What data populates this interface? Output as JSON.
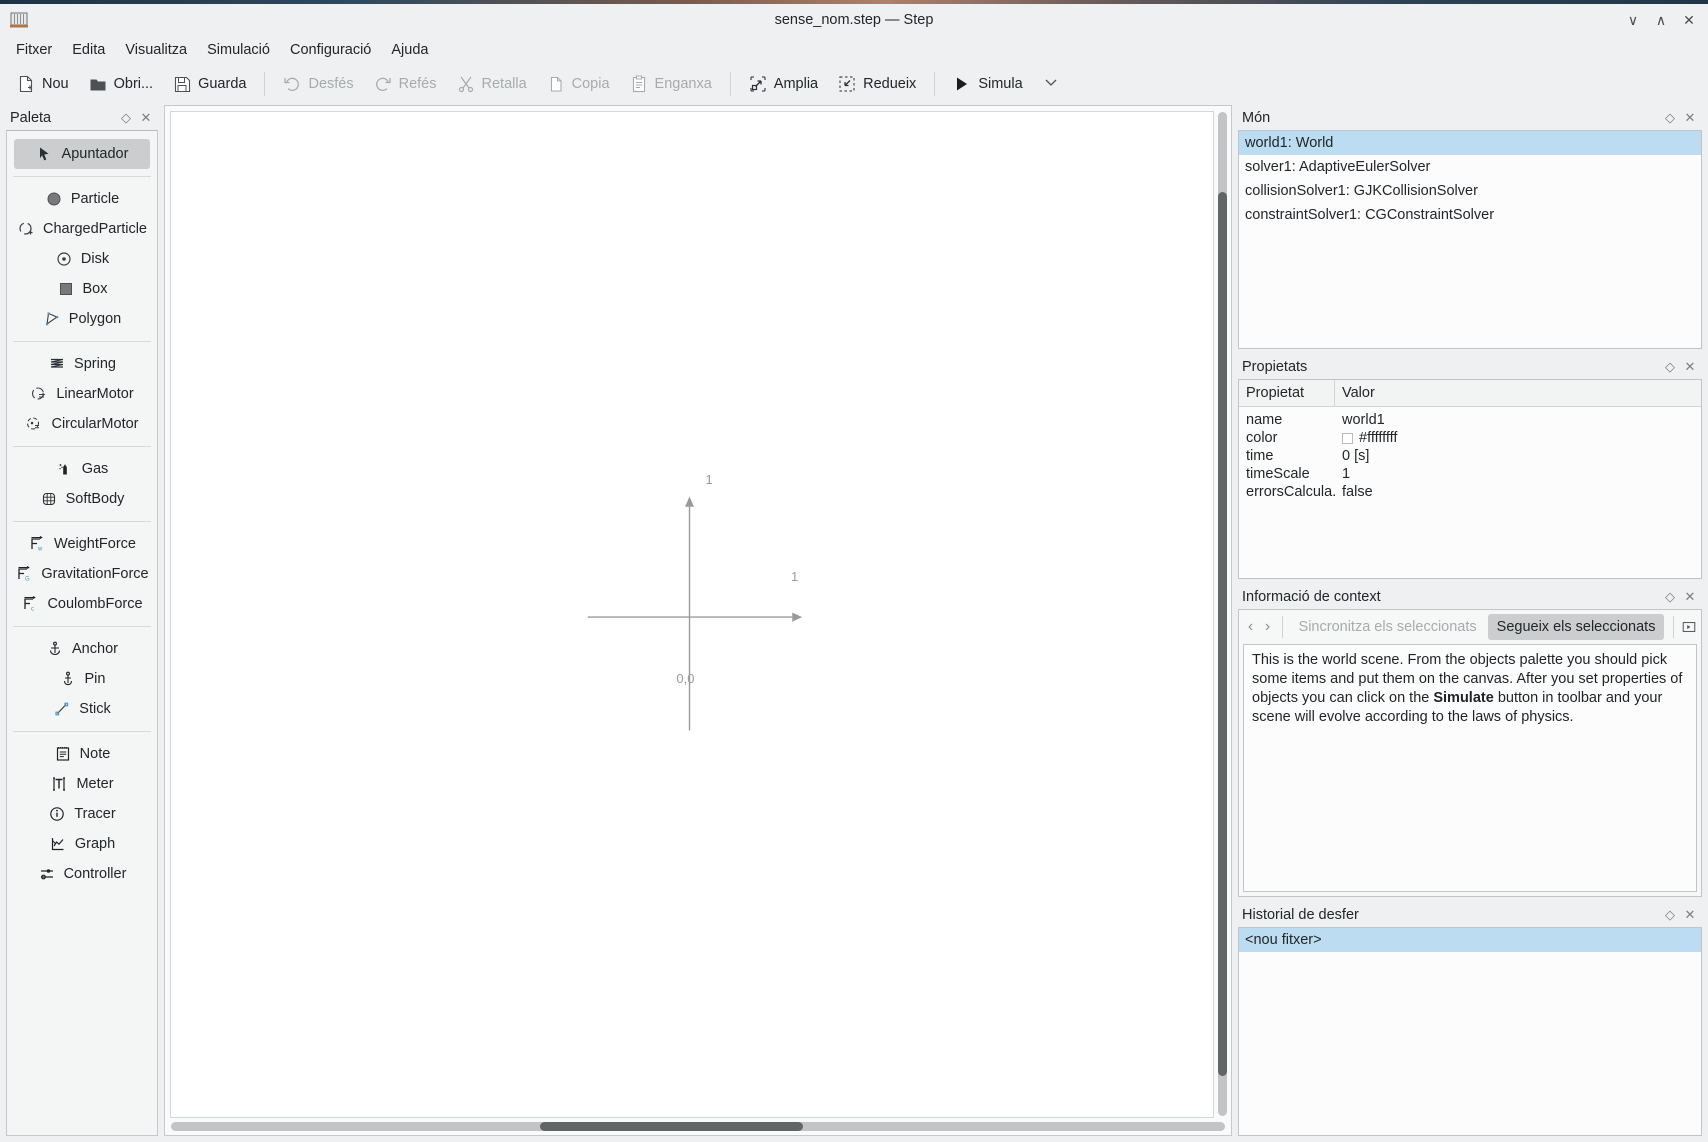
{
  "window": {
    "title": "sense_nom.step — Step",
    "app_icon": "book-icon",
    "buttons": [
      {
        "name": "minimize",
        "glyph": "∨"
      },
      {
        "name": "maximize",
        "glyph": "∧"
      },
      {
        "name": "close",
        "glyph": "✕"
      }
    ]
  },
  "menubar": {
    "items": [
      "Fitxer",
      "Edita",
      "Visualitza",
      "Simulació",
      "Configuració",
      "Ajuda"
    ]
  },
  "toolbar": {
    "items": [
      {
        "label": "Nou",
        "icon": "new-document-icon",
        "enabled": true
      },
      {
        "label": "Obri...",
        "icon": "folder-open-icon",
        "enabled": true
      },
      {
        "label": "Guarda",
        "icon": "floppy-save-icon",
        "enabled": true
      },
      {
        "separator": true
      },
      {
        "label": "Desfés",
        "icon": "undo-arrow-icon",
        "enabled": false
      },
      {
        "label": "Refés",
        "icon": "redo-arrow-icon",
        "enabled": false
      },
      {
        "label": "Retalla",
        "icon": "scissors-icon",
        "enabled": false
      },
      {
        "label": "Copia",
        "icon": "copy-page-icon",
        "enabled": false
      },
      {
        "label": "Enganxa",
        "icon": "clipboard-paste-icon",
        "enabled": false
      },
      {
        "separator": true
      },
      {
        "label": "Amplia",
        "icon": "zoom-in-icon",
        "enabled": true
      },
      {
        "label": "Redueix",
        "icon": "zoom-out-icon",
        "enabled": true
      },
      {
        "separator": true
      },
      {
        "label": "Simula",
        "icon": "play-triangle-icon",
        "enabled": true
      },
      {
        "label": "",
        "icon": "chevron-down-icon",
        "enabled": true
      }
    ]
  },
  "palette": {
    "title": "Paleta",
    "float_glyph": "◇",
    "close_glyph": "✕",
    "groups": [
      [
        {
          "label": "Apuntador",
          "icon": "cursor-arrow-icon",
          "selected": true
        }
      ],
      [
        {
          "label": "Particle",
          "icon": "filled-circle-icon"
        },
        {
          "label": "ChargedParticle",
          "icon": "charged-particle-icon"
        },
        {
          "label": "Disk",
          "icon": "disk-icon"
        },
        {
          "label": "Box",
          "icon": "filled-square-icon"
        },
        {
          "label": "Polygon",
          "icon": "polygon-icon"
        }
      ],
      [
        {
          "label": "Spring",
          "icon": "spring-coil-icon"
        },
        {
          "label": "LinearMotor",
          "icon": "linear-motor-icon"
        },
        {
          "label": "CircularMotor",
          "icon": "circular-motor-icon"
        }
      ],
      [
        {
          "label": "Gas",
          "icon": "gas-bottle-icon"
        },
        {
          "label": "SoftBody",
          "icon": "soft-body-grid-icon"
        }
      ],
      [
        {
          "label": "WeightForce",
          "icon": "force-vector-w-icon"
        },
        {
          "label": "GravitationForce",
          "icon": "force-vector-g-icon"
        },
        {
          "label": "CoulombForce",
          "icon": "force-vector-c-icon"
        }
      ],
      [
        {
          "label": "Anchor",
          "icon": "anchor-icon"
        },
        {
          "label": "Pin",
          "icon": "pin-icon"
        },
        {
          "label": "Stick",
          "icon": "stick-icon"
        }
      ],
      [
        {
          "label": "Note",
          "icon": "note-icon"
        },
        {
          "label": "Meter",
          "icon": "meter-t-icon"
        },
        {
          "label": "Tracer",
          "icon": "info-circle-icon"
        },
        {
          "label": "Graph",
          "icon": "graph-chart-icon"
        },
        {
          "label": "Controller",
          "icon": "controller-sliders-icon"
        }
      ]
    ]
  },
  "canvas": {
    "axis_origin_label": "0,0",
    "x_tick_label": "1",
    "y_tick_label": "1",
    "axis_color": "#9a9a9a",
    "background": "#ffffff",
    "hscroll": {
      "left_pct": 35,
      "width_pct": 25
    },
    "vscroll": {
      "top_pct": 8,
      "height_pct": 88
    }
  },
  "world_dock": {
    "title": "Món",
    "float_glyph": "◇",
    "close_glyph": "✕",
    "rows": [
      {
        "label": "world1: World",
        "selected": true
      },
      {
        "label": "solver1: AdaptiveEulerSolver",
        "selected": false
      },
      {
        "label": "collisionSolver1: GJKCollisionSolver",
        "selected": false
      },
      {
        "label": "constraintSolver1: CGConstraintSolver",
        "selected": false
      }
    ]
  },
  "properties_dock": {
    "title": "Propietats",
    "float_glyph": "◇",
    "close_glyph": "✕",
    "columns": [
      "Propietat",
      "Valor"
    ],
    "rows": [
      {
        "key": "name",
        "value": "world1",
        "swatch": null
      },
      {
        "key": "color",
        "value": "#ffffffff",
        "swatch": "#ffffff"
      },
      {
        "key": "time",
        "value": "0 [s]",
        "swatch": null
      },
      {
        "key": "timeScale",
        "value": "1",
        "swatch": null
      },
      {
        "key": "errorsCalcula...",
        "value": "false",
        "swatch": null
      }
    ]
  },
  "context_dock": {
    "title": "Informació de context",
    "float_glyph": "◇",
    "close_glyph": "✕",
    "back_glyph": "‹",
    "forward_glyph": "›",
    "sync_button": "Sincronitza els seleccionats",
    "follow_button": "Segueix els seleccionats",
    "open_external_icon": "open-in-window-icon",
    "body_parts": [
      {
        "text": "This is the world scene. From the objects palette you should pick some items and put them on the canvas. After you set properties of objects you can click on the ",
        "bold": false
      },
      {
        "text": "Simulate",
        "bold": true
      },
      {
        "text": " button in toolbar and your scene will evolve according to the laws of physics.",
        "bold": false
      }
    ]
  },
  "undo_dock": {
    "title": "Historial de desfer",
    "float_glyph": "◇",
    "close_glyph": "✕",
    "rows": [
      {
        "label": "<nou fitxer>",
        "selected": true
      }
    ]
  },
  "colors": {
    "selection_blue": "#bcdcf2",
    "panel_bg": "#eff0f1",
    "pressed_gray": "#cbcdce"
  }
}
